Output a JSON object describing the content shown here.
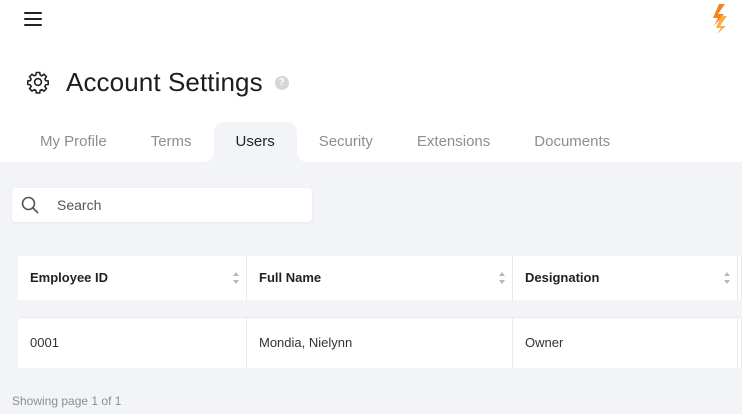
{
  "header": {
    "menu_icon": "hamburger-menu-icon",
    "logo_icon": "brand-logo-icon"
  },
  "page": {
    "title": "Account Settings",
    "title_icon": "gear-icon",
    "help_icon": "help-circle-icon",
    "help_glyph": "?"
  },
  "tabs": [
    {
      "label": "My Profile",
      "active": false
    },
    {
      "label": "Terms",
      "active": false
    },
    {
      "label": "Users",
      "active": true
    },
    {
      "label": "Security",
      "active": false
    },
    {
      "label": "Extensions",
      "active": false
    },
    {
      "label": "Documents",
      "active": false
    }
  ],
  "search": {
    "placeholder": "Search",
    "value": "",
    "icon": "search-icon"
  },
  "table": {
    "columns": [
      "Employee ID",
      "Full Name",
      "Designation",
      ""
    ],
    "rows": [
      [
        "0001",
        "Mondia, Nielynn",
        "Owner",
        ""
      ]
    ]
  },
  "footer": {
    "pagination_text": "Showing page 1 of 1"
  },
  "colors": {
    "accent_orange": "#f5821f",
    "accent_yellow": "#fbb040",
    "content_bg": "#f2f4f8",
    "active_tab_text": "#222222",
    "inactive_tab_text": "#8a8f96"
  }
}
